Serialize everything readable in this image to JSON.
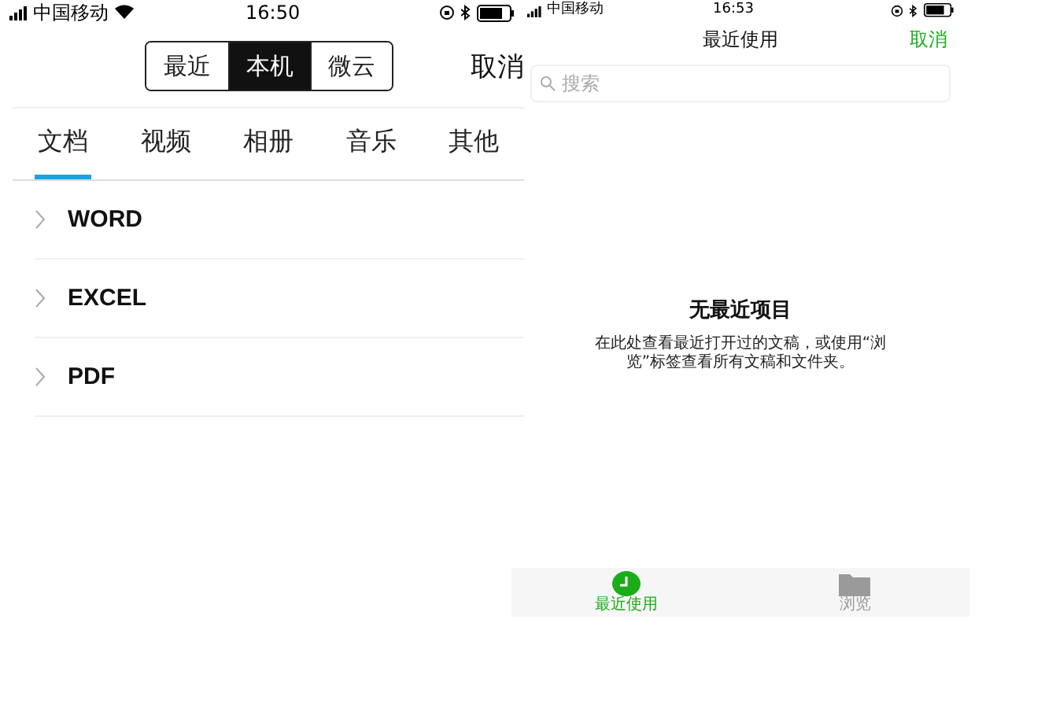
{
  "left_screen": {
    "status_bar": {
      "carrier": "中国移动",
      "time": "16:50"
    },
    "source_switch": [
      {
        "label": "最近",
        "selected": false
      },
      {
        "label": "本机",
        "selected": true
      },
      {
        "label": "微云",
        "selected": false
      }
    ],
    "cancel": "取消",
    "tabs": [
      {
        "label": "文档",
        "selected": true
      },
      {
        "label": "视频",
        "selected": false
      },
      {
        "label": "相册",
        "selected": false
      },
      {
        "label": "音乐",
        "selected": false
      },
      {
        "label": "其他",
        "selected": false
      }
    ],
    "folders": [
      {
        "name": "WORD"
      },
      {
        "name": "EXCEL"
      },
      {
        "name": "PDF"
      }
    ]
  },
  "right_screen": {
    "status_bar": {
      "carrier": "中国移动",
      "time": "16:53"
    },
    "title": "最近使用",
    "cancel": "取消",
    "search": {
      "placeholder": "搜索"
    },
    "empty_state": {
      "title": "无最近项目",
      "description": "在此处查看最近打开过的文稿，或使用“浏览”标签查看所有文稿和文件夹。"
    },
    "tab_bar": [
      {
        "label": "最近使用",
        "selected": true,
        "kind": "clock"
      },
      {
        "label": "浏览",
        "selected": false,
        "kind": "folder"
      }
    ]
  }
}
